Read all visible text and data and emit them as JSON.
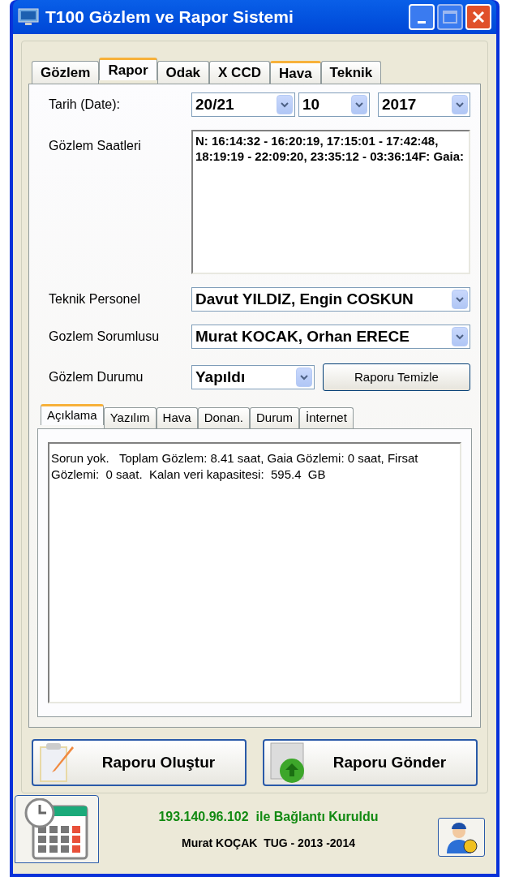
{
  "window": {
    "title": "T100 Gözlem ve Rapor Sistemi"
  },
  "tabs": [
    {
      "label": "Gözlem",
      "selected": false
    },
    {
      "label": "Rapor",
      "selected": true
    },
    {
      "label": "Odak",
      "selected": false
    },
    {
      "label": "X CCD",
      "selected": false
    },
    {
      "label": "Hava",
      "selected": false,
      "hover": true
    },
    {
      "label": "Teknik",
      "selected": false
    }
  ],
  "date": {
    "label": "Tarih (Date):",
    "day": "20/21",
    "month": "10",
    "year": "2017"
  },
  "hours": {
    "label": "Gözlem Saatleri",
    "value": "N: 16:14:32 - 16:20:19, 17:15:01 - 17:42:48, 18:19:19 - 22:09:20, 23:35:12 - 03:36:14F: Gaia:"
  },
  "technical_staff": {
    "label": "Teknik Personel",
    "value": "Davut YILDIZ, Engin COSKUN"
  },
  "observer": {
    "label": "Gozlem Sorumlusu",
    "value": "Murat KOCAK, Orhan ERECE"
  },
  "status": {
    "label": "Gözlem Durumu",
    "value": "Yapıldı"
  },
  "clear_button": "Raporu Temizle",
  "report_tabs": [
    {
      "label": "Açıklama",
      "selected": true
    },
    {
      "label": "Yazılım",
      "selected": false
    },
    {
      "label": "Hava",
      "selected": false
    },
    {
      "label": "Donan.",
      "selected": false
    },
    {
      "label": "Durum",
      "selected": false
    },
    {
      "label": "İnternet",
      "selected": false
    }
  ],
  "description": "Sorun yok.   Toplam Gözlem: 8.41 saat, Gaia Gözlemi: 0 saat, Firsat Gözlemi:  0 saat.  Kalan veri kapasitesi:  595.4  GB",
  "buttons": [
    {
      "label": "Raporu Oluştur",
      "kind": "create"
    },
    {
      "label": "Raporu Gönder",
      "kind": "send"
    }
  ],
  "status_bar": {
    "connection": "193.140.96.102  ile Bağlantı Kuruldu",
    "credit": "Murat KOÇAK  TUG - 2013 -2014"
  }
}
